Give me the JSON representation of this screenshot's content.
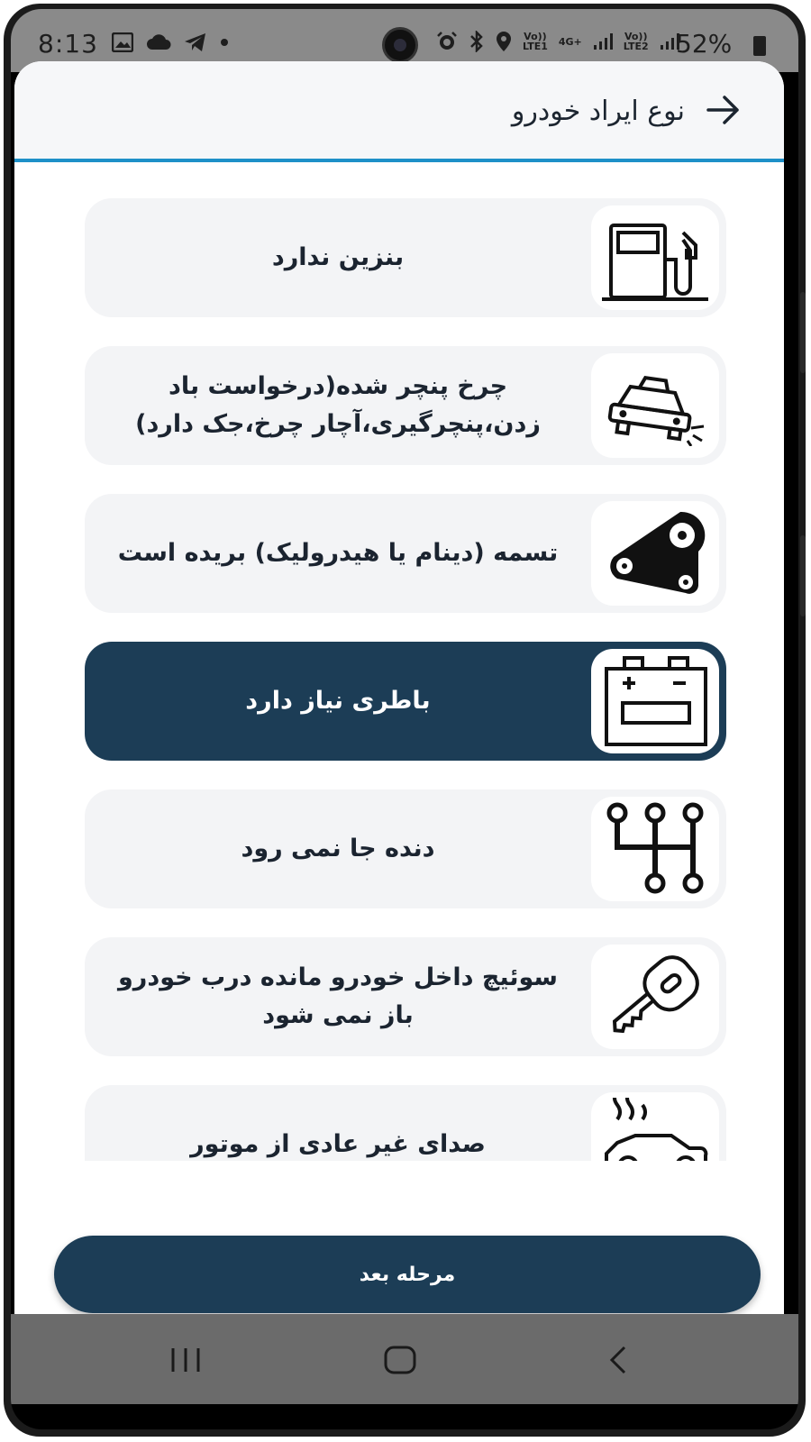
{
  "status_bar": {
    "time": "8:13",
    "battery": "52%",
    "net1": "Vo))\nLTE1",
    "net2": "4G+",
    "net3": "Vo))\nLTE2"
  },
  "header": {
    "title": "نوع ایراد خودرو"
  },
  "items": [
    {
      "label": "بنزین ندارد",
      "icon": "fuel-pump-icon",
      "selected": false
    },
    {
      "label": "چرخ پنچر شده(درخواست باد زدن،پنچرگیری،آچار چرخ،جک دارد)",
      "icon": "car-flat-tire-icon",
      "selected": false
    },
    {
      "label": "تسمه (دینام یا هیدرولیک) بریده است",
      "icon": "belt-pulley-icon",
      "selected": false
    },
    {
      "label": "باطری نیاز دارد",
      "icon": "car-battery-icon",
      "selected": true
    },
    {
      "label": "دنده جا نمی رود",
      "icon": "gear-shift-icon",
      "selected": false
    },
    {
      "label": "سوئیچ داخل خودرو مانده درب خودرو باز نمی شود",
      "icon": "car-key-icon",
      "selected": false
    },
    {
      "label": "صدای غیر عادی از موتور",
      "icon": "overheating-car-icon",
      "selected": false
    }
  ],
  "next_button": {
    "label": "مرحله بعد"
  },
  "colors": {
    "primary": "#1c3d56",
    "accent_line": "#1e90c8",
    "item_bg": "#f3f4f6"
  }
}
